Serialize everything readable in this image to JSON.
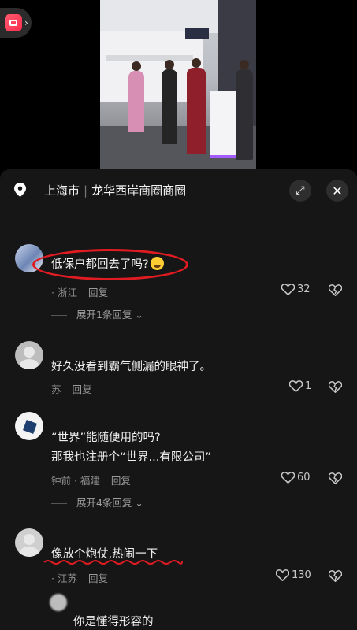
{
  "app": {
    "badge_icon": "app-logo-icon",
    "badge_chevron": "›"
  },
  "location": {
    "city": "上海市",
    "area": "龙华西岸商圈商圈"
  },
  "controls": {
    "expand_icon": "⤢",
    "close_icon": "✕"
  },
  "comment_count": "",
  "comments": [
    {
      "username": "",
      "text": "低保户都回去了吗?",
      "has_emoji": true,
      "meta_time": "",
      "meta_region": "· 浙江",
      "reply_label": "回复",
      "likes": "32",
      "expand_replies": "展开1条回复"
    },
    {
      "username": "",
      "text": "好久没看到霸气侧漏的眼神了。",
      "meta_time": "",
      "meta_region": "苏",
      "reply_label": "回复",
      "likes": "1"
    },
    {
      "username": "",
      "text_line1": "“世界”能随便用的吗?",
      "text_line2": "那我也注册个“世界...有限公司”",
      "meta_time": "钟前 · 福建",
      "reply_label": "回复",
      "likes": "60",
      "expand_replies": "展开4条回复"
    },
    {
      "username": "",
      "text": "像放个炮仗,热闹一下",
      "meta_time": "",
      "meta_region": "· 江苏",
      "reply_label": "回复",
      "likes": "130",
      "sub_reply": {
        "username": "",
        "text": "你是懂得形容的"
      }
    }
  ],
  "colors": {
    "panel_bg": "#161616",
    "annotation_red": "#e01b22",
    "text": "#f0f0f0",
    "meta": "#8c8c8c"
  }
}
